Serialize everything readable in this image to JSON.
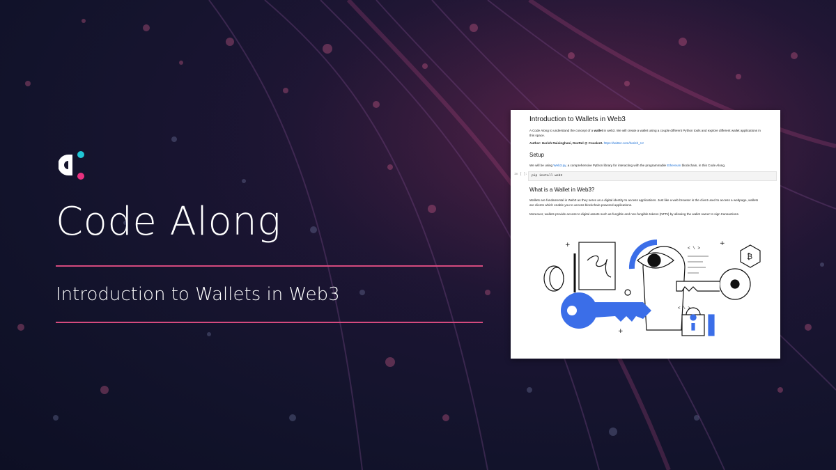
{
  "brand": {
    "logo": "covalent-logo-icon",
    "colors": {
      "white": "#ffffff",
      "cyan": "#20c6d6",
      "pink": "#e8317f",
      "rule": "#d54a7e",
      "accent_blue": "#3b6ee8"
    }
  },
  "hero": {
    "title": "Code Along",
    "subtitle": "Introduction to Wallets in Web3"
  },
  "notebook": {
    "title": "Introduction to Wallets in Web3",
    "intro_pre": "A Code Along to understand the concept of a ",
    "intro_bold": "wallet",
    "intro_post": " in web3. We will create a wallet using a couple different Python tools and explore different wallet applications in this space.",
    "author_label": "Author: Harish Raisinghani, DevRel @ Covalent.",
    "author_link": "https://twitter.com/harish_rvr",
    "setup_heading": "Setup",
    "setup_pre": "We will be using ",
    "setup_link1": "Web3.py",
    "setup_mid": ", a comprehensive Python library for interacting with the programmable ",
    "setup_link2": "Ethereum",
    "setup_post": " blockchain, in this Code Along.",
    "cell_prompt": "In [ ]:",
    "code": "pip install web3",
    "wallet_heading": "What is a Wallet in Web3?",
    "wallet_p1": "Wallets are fundamental in Web3 as they serve as a digital identity to access applications. Just like a web browser is the client used to access a webpage, wallets are clients which enable you to access blockchain-powered applications.",
    "wallet_p2": "Moreover, wallets provide access to digital assets such as fungible and non-fungible tokens (NFTs) by allowing the wallet owner to sign transactions.",
    "illustration": "wallet-keys-illustration",
    "illustration_glyphs": {
      "code_tag_1": "< \\ >",
      "code_tag_2": "< \\ >",
      "plus": "+"
    }
  }
}
